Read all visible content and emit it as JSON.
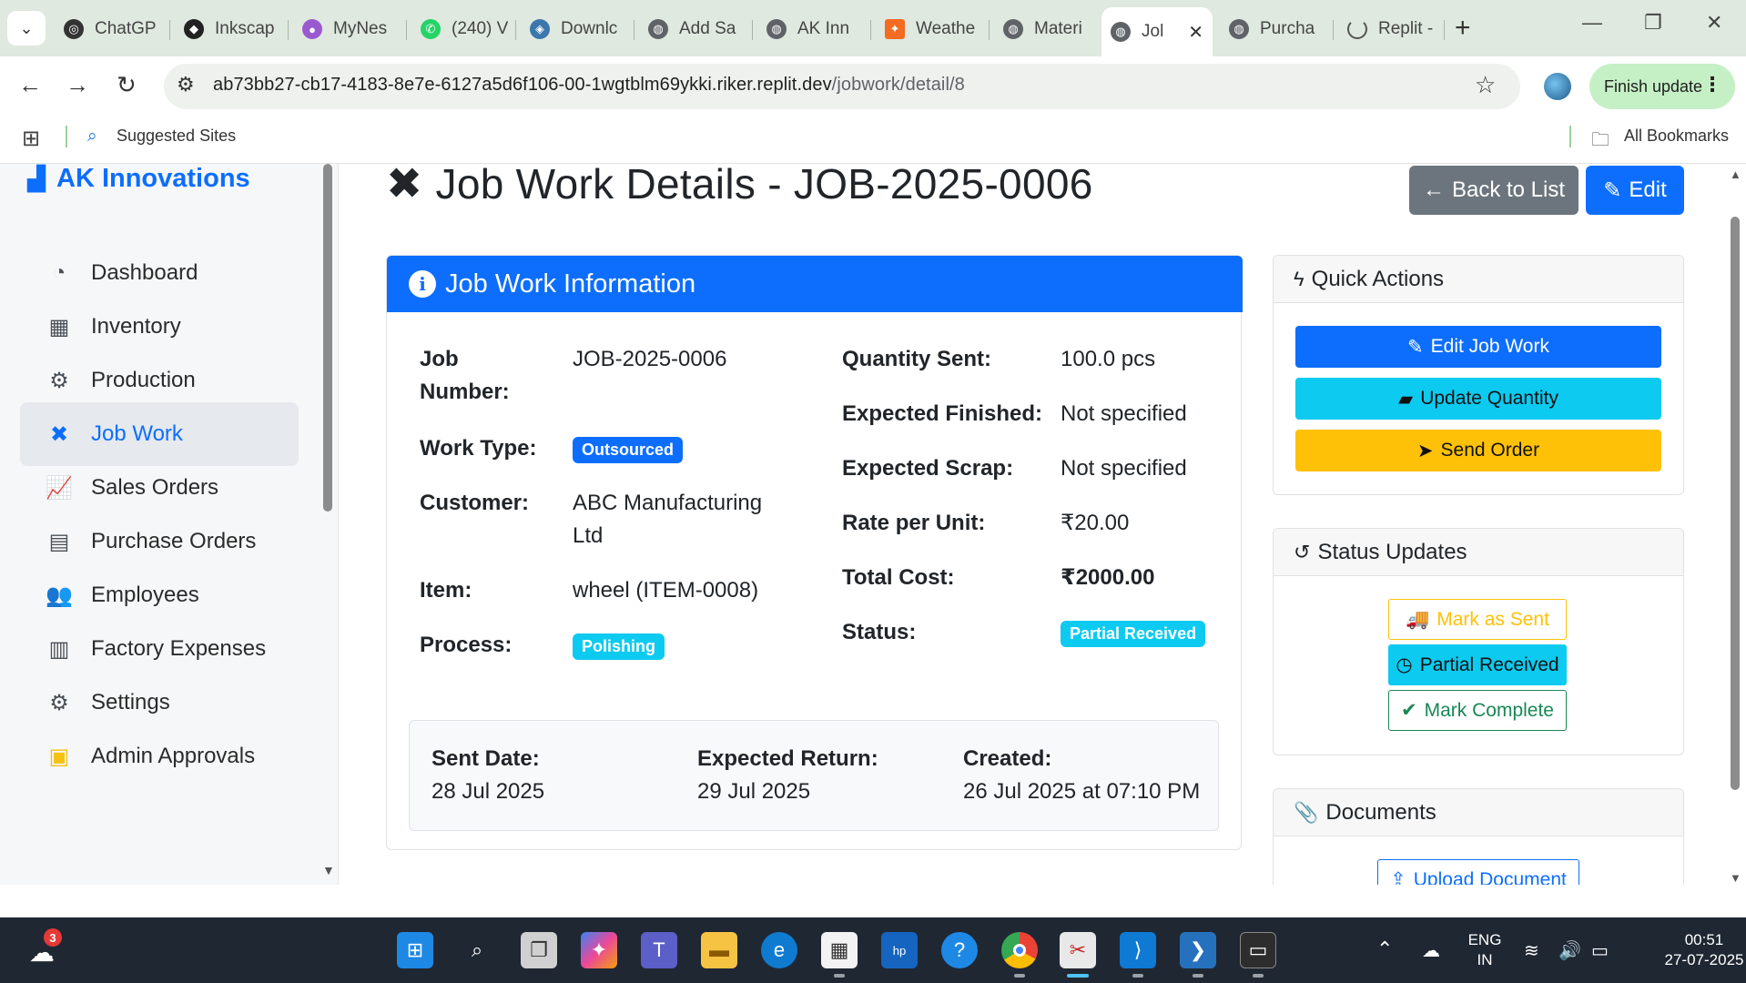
{
  "browser": {
    "tabs": [
      {
        "label": "ChatGP",
        "icon": "chatgpt-icon"
      },
      {
        "label": "Inkscap",
        "icon": "inkscape-icon"
      },
      {
        "label": "MyNes",
        "icon": "mynes-icon"
      },
      {
        "label": "(240) V",
        "icon": "whatsapp-icon"
      },
      {
        "label": "Downlc",
        "icon": "python-icon"
      },
      {
        "label": "Add Sa",
        "icon": "globe-icon"
      },
      {
        "label": "AK Inn",
        "icon": "globe-icon"
      },
      {
        "label": "Weathe",
        "icon": "weather-icon"
      },
      {
        "label": "Materi",
        "icon": "globe-icon"
      },
      {
        "label": "Jol",
        "icon": "globe-icon",
        "active": true
      },
      {
        "label": "Purcha",
        "icon": "globe-icon"
      },
      {
        "label": "Replit -",
        "icon": "replit-loading-icon"
      }
    ],
    "url_host": "ab73bb27-cb17-4183-8e7e-6127a5d6f106-00-1wgtblm69ykki.riker.replit.dev",
    "url_path": "/jobwork/detail/8",
    "finish_update": "Finish update",
    "bookmarks": {
      "suggested": "Suggested Sites",
      "all": "All Bookmarks"
    }
  },
  "sidebar": {
    "brand": "AK Innovations",
    "items": [
      {
        "label": "Dashboard",
        "icon": "dashboard-icon"
      },
      {
        "label": "Inventory",
        "icon": "inventory-icon"
      },
      {
        "label": "Production",
        "icon": "production-icon"
      },
      {
        "label": "Job Work",
        "icon": "job-work-icon",
        "active": true
      },
      {
        "label": "Sales Orders",
        "icon": "chart-line-icon"
      },
      {
        "label": "Purchase Orders",
        "icon": "purchase-order-icon"
      },
      {
        "label": "Employees",
        "icon": "employees-icon"
      },
      {
        "label": "Factory Expenses",
        "icon": "receipt-icon"
      },
      {
        "label": "Settings",
        "icon": "gear-icon"
      },
      {
        "label": "Admin Approvals",
        "icon": "clipboard-icon"
      }
    ]
  },
  "header": {
    "title": "Job Work Details - JOB-2025-0006",
    "back_label": "Back to List",
    "edit_label": "Edit"
  },
  "info": {
    "title": "Job Work Information",
    "job_number_label_1": "Job",
    "job_number_label_2": "Number:",
    "job_number": "JOB-2025-0006",
    "work_type_label": "Work Type:",
    "work_type": "Outsourced",
    "customer_label": "Customer:",
    "customer_line1": "ABC Manufacturing",
    "customer_line2": "Ltd",
    "item_label": "Item:",
    "item": "wheel (ITEM-0008)",
    "process_label": "Process:",
    "process": "Polishing",
    "qty_sent_label": "Quantity Sent:",
    "qty_sent": "100.0 pcs",
    "exp_finished_label": "Expected Finished:",
    "exp_finished": "Not specified",
    "exp_scrap_label": "Expected Scrap:",
    "exp_scrap": "Not specified",
    "rate_label": "Rate per Unit:",
    "rate": "₹20.00",
    "total_label": "Total Cost:",
    "total": "₹2000.00",
    "status_label": "Status:",
    "status": "Partial Received",
    "sent_date_label": "Sent Date:",
    "sent_date": "28 Jul 2025",
    "expected_return_label": "Expected Return:",
    "expected_return": "29 Jul 2025",
    "created_label": "Created:",
    "created": "26 Jul 2025 at 07:10 PM"
  },
  "quick_actions": {
    "title": "Quick Actions",
    "edit": "Edit Job Work",
    "update_qty": "Update Quantity",
    "send_order": "Send Order"
  },
  "status_updates": {
    "title": "Status Updates",
    "mark_sent": "Mark as Sent",
    "partial": "Partial Received",
    "complete": "Mark Complete"
  },
  "documents": {
    "title": "Documents",
    "upload": "Upload Document"
  },
  "taskbar": {
    "weather_badge": "3",
    "lang_1": "ENG",
    "lang_2": "IN",
    "time": "00:51",
    "date": "27-07-2025"
  },
  "colors": {
    "primary": "#0d6efd",
    "info": "#0dcaf0",
    "warning": "#ffc107",
    "success": "#198754",
    "secondary": "#6c757d"
  }
}
